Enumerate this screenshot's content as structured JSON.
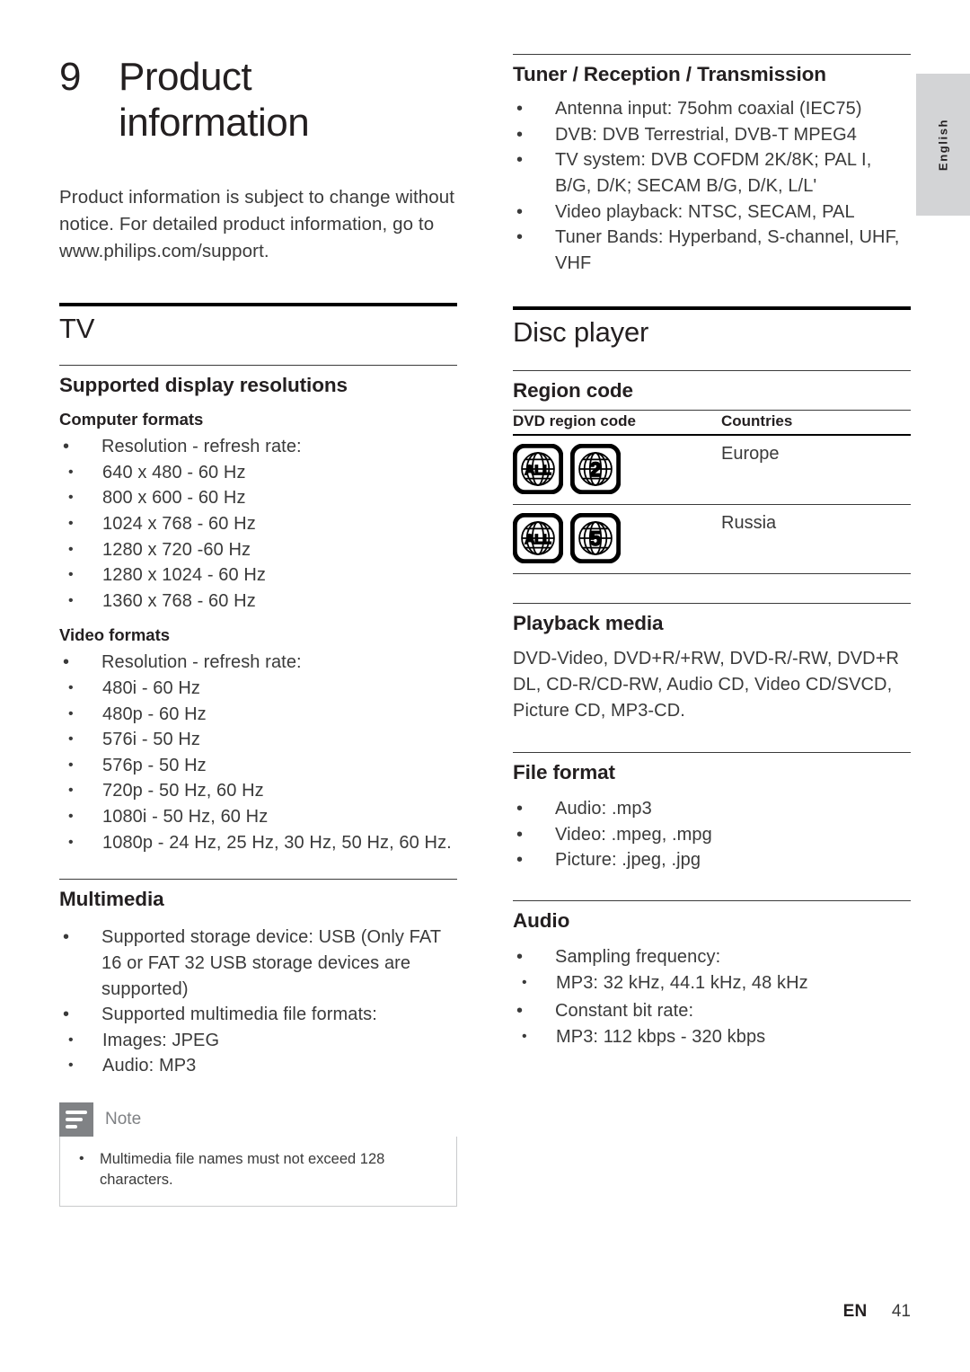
{
  "language_tab": {
    "label": "English"
  },
  "left_column": {
    "chapter": {
      "number": "9",
      "title_line1": "Product",
      "title_line2": "information"
    },
    "intro": "Product information is subject to change without notice. For detailed product information, go to www.philips.com/support.",
    "tv_section": {
      "h1": "TV",
      "supported_display": {
        "h2": "Supported display resolutions",
        "computer_formats": {
          "h3": "Computer formats",
          "bullet": "Resolution - refresh rate:",
          "items": [
            "640 x 480 - 60 Hz",
            "800 x 600 - 60 Hz",
            "1024 x 768 - 60 Hz",
            "1280 x 720 -60 Hz",
            "1280 x 1024 - 60 Hz",
            "1360 x 768 - 60 Hz"
          ]
        },
        "video_formats": {
          "h3": "Video formats",
          "bullet": "Resolution - refresh rate:",
          "items": [
            "480i - 60 Hz",
            "480p - 60 Hz",
            "576i - 50 Hz",
            "576p - 50 Hz",
            "720p - 50 Hz, 60 Hz",
            "1080i - 50 Hz, 60 Hz",
            "1080p - 24 Hz, 25 Hz, 30 Hz, 50 Hz, 60 Hz."
          ]
        }
      },
      "multimedia": {
        "h2": "Multimedia",
        "items": [
          "Supported storage device: USB (Only FAT 16 or FAT 32 USB storage devices are supported)",
          "Supported multimedia file formats:"
        ],
        "subitems": [
          "Images: JPEG",
          "Audio: MP3"
        ]
      },
      "note": {
        "title": "Note",
        "icon": "note-lines-icon",
        "items": [
          "Multimedia file names must not exceed 128 characters."
        ]
      }
    }
  },
  "right_column": {
    "tuner": {
      "h2": "Tuner / Reception / Transmission",
      "items": [
        "Antenna input: 75ohm coaxial (IEC75)",
        "DVB: DVB Terrestrial, DVB-T MPEG4",
        "TV system: DVB COFDM 2K/8K; PAL I, B/G, D/K; SECAM B/G, D/K, L/L'",
        "Video playback: NTSC, SECAM, PAL",
        "Tuner Bands: Hyperband, S-channel, UHF, VHF"
      ]
    },
    "disc_player": {
      "h1": "Disc player",
      "region_code": {
        "h2": "Region code",
        "columns": [
          "DVD region code",
          "Countries"
        ],
        "rows": [
          {
            "codes": [
              "ALL",
              "2"
            ],
            "country": "Europe"
          },
          {
            "codes": [
              "ALL",
              "5"
            ],
            "country": "Russia"
          }
        ]
      },
      "playback_media": {
        "h2": "Playback media",
        "text": "DVD-Video, DVD+R/+RW, DVD-R/-RW, DVD+R DL, CD-R/CD-RW, Audio CD, Video CD/SVCD, Picture CD, MP3-CD."
      },
      "file_format": {
        "h2": "File format",
        "items": [
          "Audio: .mp3",
          "Video: .mpeg, .mpg",
          "Picture: .jpeg, .jpg"
        ]
      },
      "audio": {
        "h2": "Audio",
        "groups": [
          {
            "label": "Sampling frequency:",
            "items": [
              "MP3: 32 kHz, 44.1 kHz, 48 kHz"
            ]
          },
          {
            "label": "Constant bit rate:",
            "items": [
              "MP3: 112 kbps - 320 kbps"
            ]
          }
        ]
      }
    }
  },
  "footer": {
    "lang_code": "EN",
    "page_number": "41"
  },
  "colors": {
    "text": "#3a3a3a",
    "heading": "#231f20",
    "rule": "#3b3b3b",
    "note_gray": "#808285",
    "tab_gray": "#d3d4d6"
  }
}
